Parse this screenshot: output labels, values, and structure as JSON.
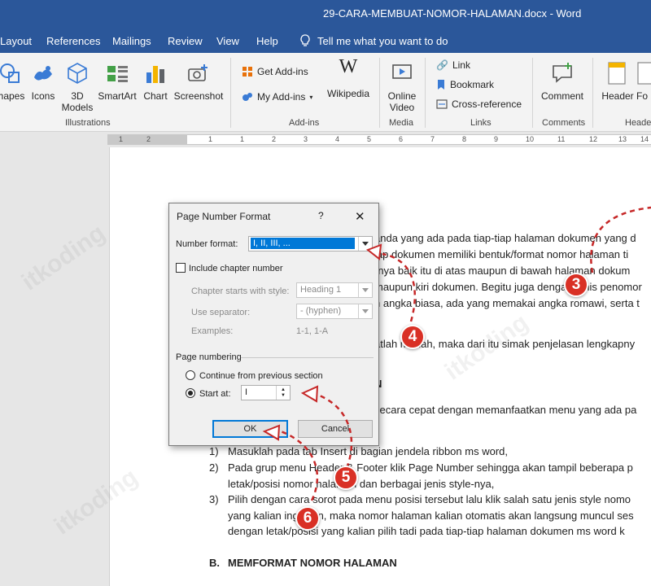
{
  "window": {
    "title": "29-CARA-MEMBUAT-NOMOR-HALAMAN.docx  -  Word"
  },
  "tabs": [
    "Layout",
    "References",
    "Mailings",
    "Review",
    "View",
    "Help"
  ],
  "tell_me": "Tell me what you want to do",
  "ribbon": {
    "illustrations": {
      "items": [
        "hapes",
        "Icons",
        "3D Models",
        "SmartArt",
        "Chart",
        "Screenshot"
      ],
      "label": "Illustrations"
    },
    "addins": {
      "get": "Get Add-ins",
      "my": "My Add-ins",
      "wikipedia": "Wikipedia",
      "label": "Add-ins"
    },
    "media": {
      "online_video": "Online Video",
      "label": "Media"
    },
    "links": {
      "link": "Link",
      "bookmark": "Bookmark",
      "cross_reference": "Cross-reference",
      "label": "Links"
    },
    "comments": {
      "comment": "Comment",
      "label": "Comments"
    },
    "header_footer": {
      "header": "Header",
      "footer": "Fo",
      "label": "Heade"
    }
  },
  "ruler": {
    "ticks": [
      "1",
      "2",
      "1",
      "1",
      "2",
      "3",
      "4",
      "5",
      "6",
      "7",
      "8",
      "9",
      "10",
      "11",
      "12",
      "13",
      "14"
    ]
  },
  "document": {
    "lines": [
      "anda yang ada pada tiap-tiap halaman dokumen yang d",
      "iap dokumen memiliki bentuk/format nomor halaman ti",
      "-nya baik itu di atas maupun di bawah halaman dokum",
      "maupun kiri dokumen. Begitu juga dengan jenis penomor",
      "n angka biasa, ada yang memakai angka romawi, serta t",
      "atlah mudah, maka dari itu simak penjelasan lengkapny",
      "N",
      "secara cepat dengan memanfaatkan menu yang ada pa"
    ],
    "list": [
      {
        "num": "1)",
        "line1": "Masuklah pada tab Insert di bagian jendela ribbon ms word,",
        "line2": ""
      },
      {
        "num": "2)",
        "line1": "Pada grup menu Header & Footer klik Page Number sehingga akan tampil beberapa p",
        "line2": "letak/posisi nomor halaman dan berbagai jenis style-nya,"
      },
      {
        "num": "3)",
        "line1": "Pilih dengan cara sorot pada menu posisi tersebut lalu klik salah satu jenis style nomo",
        "line2": "yang kalian inginkan, maka nomor halaman kalian otomatis akan langsung muncul ses",
        "line3": "dengan letak/posisi yang kalian pilih tadi pada tiap-tiap halaman dokumen ms word k"
      }
    ],
    "section_b_num": "B.",
    "section_b": "MEMFORMAT NOMOR HALAMAN"
  },
  "dialog": {
    "title": "Page Number Format",
    "help": "?",
    "close": "✕",
    "number_format_label": "Number format:",
    "number_format_value": "I, II, III, ...",
    "include_chapter": "Include chapter number",
    "chapter_style_label": "Chapter starts with style:",
    "chapter_style_value": "Heading 1",
    "separator_label": "Use separator:",
    "separator_value": "-   (hyphen)",
    "examples_label": "Examples:",
    "examples_value": "1-1, 1-A",
    "page_numbering_label": "Page numbering",
    "continue_label": "Continue from previous section",
    "start_at_label": "Start at:",
    "start_at_value": "I",
    "ok": "OK",
    "cancel": "Cancel"
  },
  "markers": [
    "3",
    "4",
    "5",
    "6"
  ],
  "watermark": "itkoding",
  "colors": {
    "word_blue": "#2b579a",
    "marker_red": "#d93025"
  }
}
